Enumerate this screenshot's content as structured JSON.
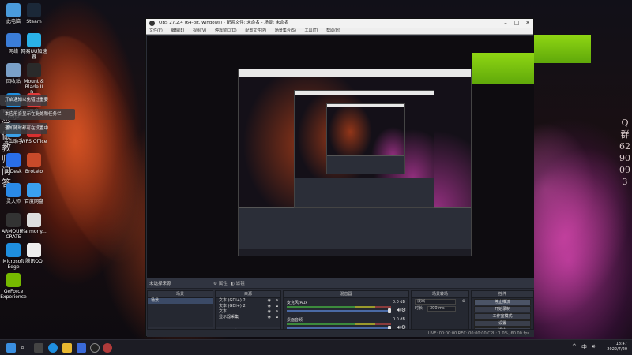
{
  "watermark_right": "Q群6290093",
  "watermark_left": "学做教师问答",
  "desktop_icons": [
    {
      "label": "此电脑",
      "color": "#4a9bdc"
    },
    {
      "label": "Steam",
      "color": "#1b2838"
    },
    {
      "label": "网络",
      "color": "#3b7dd8"
    },
    {
      "label": "网易UU加速器",
      "color": "#2ab2e8"
    },
    {
      "label": "回收站",
      "color": "#7aa0c8"
    },
    {
      "label": "Mount & Blade II B...",
      "color": "#2a2a2a"
    },
    {
      "label": "Microsoft Edge",
      "color": "#1f8fe0"
    },
    {
      "label": "云盘",
      "color": "#e03a3a"
    },
    {
      "label": "金山助手",
      "color": "#3aa0e8"
    },
    {
      "label": "WPS Office",
      "color": "#d83030"
    },
    {
      "label": "ToDesk",
      "color": "#2a6ee8"
    },
    {
      "label": "Brotato",
      "color": "#c84a2a"
    },
    {
      "label": "灵大师",
      "color": "#2a8ae8"
    },
    {
      "label": "百度网盘",
      "color": "#3aa0f0"
    },
    {
      "label": "ARMOURY CRATE",
      "color": "#333333"
    },
    {
      "label": "harmony...",
      "color": "#dddddd"
    },
    {
      "label": "Microsoft Edge",
      "color": "#1f8fe0"
    },
    {
      "label": "腾讯QQ",
      "color": "#eeeeee"
    },
    {
      "label": "GeForce Experience",
      "color": "#76b900"
    }
  ],
  "notifications": [
    "开启通知以免错过重要",
    "本应用会显示在此处和任务栏",
    "通知随时都可在设置中"
  ],
  "obs": {
    "title": "OBS 27.2.4 (64-bit, windows) - 配置文件: 未命名 - 场景: 未命名",
    "menu": [
      "文件(F)",
      "编辑(E)",
      "视图(V)",
      "停靠窗口(D)",
      "配置文件(P)",
      "场景集合(S)",
      "工具(T)",
      "帮助(H)"
    ],
    "scene_bar_label": "未选择来源",
    "scene_bar_buttons": [
      "属性",
      "滤镜"
    ],
    "docks": {
      "scenes": {
        "title": "场景",
        "items": [
          "场景"
        ]
      },
      "sources": {
        "title": "来源",
        "items": [
          "文本 (GDI+) 2",
          "文本 (GDI+) 2",
          "文本",
          "显示器采集"
        ]
      },
      "mixer": {
        "title": "混音器",
        "channels": [
          {
            "name": "麦克风/Aux",
            "db": "0.0 dB"
          },
          {
            "name": "桌面音频",
            "db": "0.0 dB"
          }
        ]
      },
      "transitions": {
        "title": "场景转场",
        "type": "淡出",
        "duration_label": "时长",
        "duration": "300 ms"
      },
      "controls": {
        "title": "控件",
        "buttons": [
          "停止推流",
          "开始录制",
          "工作室模式",
          "设置",
          "退出"
        ]
      }
    },
    "status": "LIVE: 00:00:00    REC: 00:00:00    CPU: 1.0%, 60.00 fps"
  },
  "taskbar": {
    "time": "18:47",
    "date": "2022/7/20",
    "tray": [
      "^",
      "中"
    ],
    "icons": [
      "windows",
      "search",
      "taskview",
      "edge",
      "explorer",
      "store",
      "obs",
      "app"
    ]
  }
}
